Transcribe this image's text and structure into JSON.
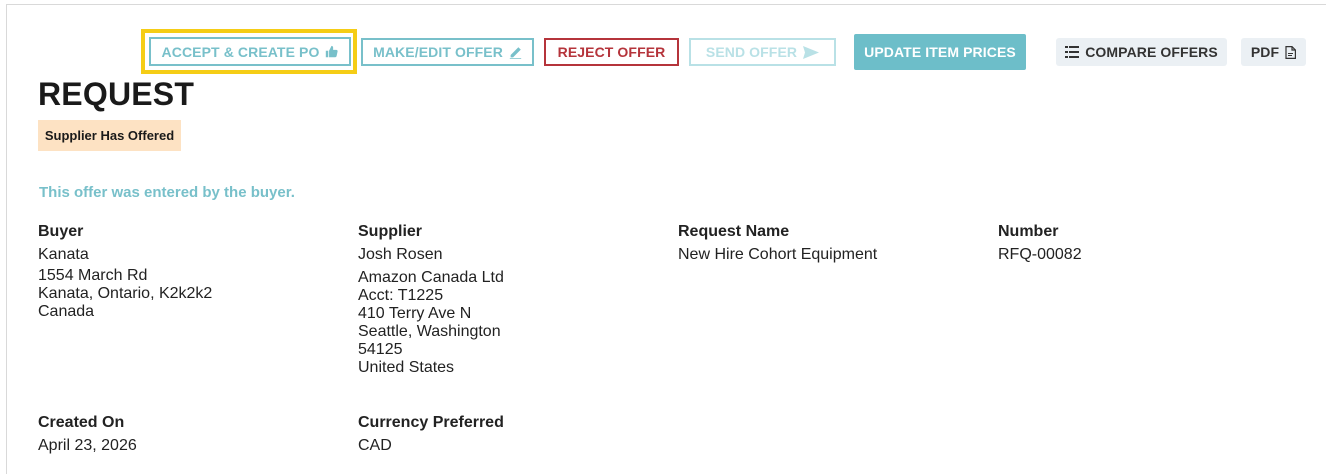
{
  "toolbar": {
    "accept_create_po": "ACCEPT & CREATE PO",
    "make_edit_offer": "MAKE/EDIT OFFER",
    "reject_offer": "REJECT OFFER",
    "send_offer": "SEND OFFER",
    "update_item_prices": "UPDATE ITEM PRICES",
    "compare_offers": "COMPARE OFFERS",
    "pdf": "PDF"
  },
  "page": {
    "title": "REQUEST",
    "status_badge": "Supplier Has Offered",
    "note": "This offer was entered by the buyer."
  },
  "details": {
    "buyer": {
      "label": "Buyer",
      "name": "Kanata",
      "address_line1": "1554 March Rd",
      "address_line2": "Kanata, Ontario, K2k2k2",
      "country": "Canada"
    },
    "supplier": {
      "label": "Supplier",
      "contact": "Josh Rosen",
      "company": "Amazon Canada Ltd",
      "account": "Acct: T1225",
      "address_line1": "410 Terry Ave N",
      "city_state": "Seattle, Washington",
      "postal": "54125",
      "country": "United States"
    },
    "request_name": {
      "label": "Request Name",
      "value": "New Hire Cohort Equipment"
    },
    "number": {
      "label": "Number",
      "value": "RFQ-00082"
    },
    "created_on": {
      "label": "Created On",
      "value": "April 23, 2026"
    },
    "currency": {
      "label": "Currency Preferred",
      "value": "CAD"
    }
  },
  "colors": {
    "accent": "#78c0ca",
    "danger": "#b5343b",
    "highlight": "#f5cd16",
    "badge_bg": "#fde2c3"
  },
  "icons": [
    "thumbs-up-icon",
    "pencil-icon",
    "send-icon",
    "list-icon",
    "pdf-file-icon"
  ]
}
